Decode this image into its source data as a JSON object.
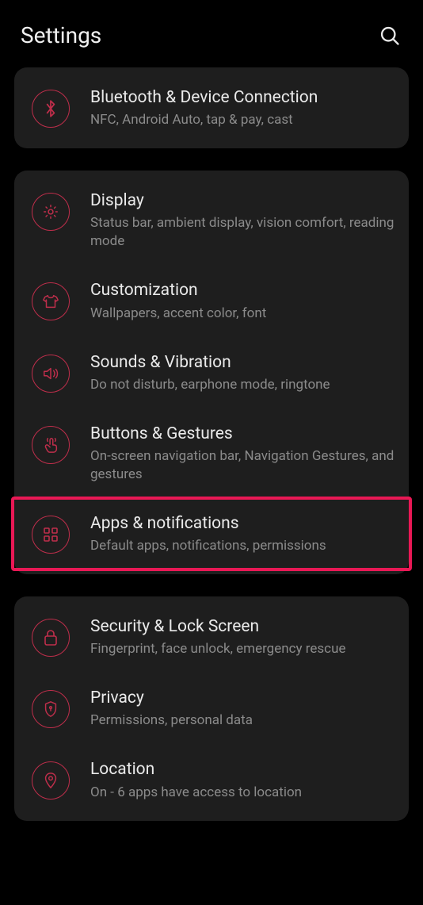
{
  "header": {
    "title": "Settings"
  },
  "groups": [
    {
      "items": [
        {
          "icon": "bluetooth",
          "title": "Bluetooth & Device Connection",
          "sub": "NFC, Android Auto, tap & pay, cast"
        }
      ]
    },
    {
      "items": [
        {
          "icon": "display",
          "title": "Display",
          "sub": "Status bar, ambient display, vision comfort, reading mode"
        },
        {
          "icon": "tshirt",
          "title": "Customization",
          "sub": "Wallpapers, accent color, font"
        },
        {
          "icon": "sound",
          "title": "Sounds & Vibration",
          "sub": "Do not disturb, earphone mode, ringtone"
        },
        {
          "icon": "gesture",
          "title": "Buttons & Gestures",
          "sub": "On-screen navigation bar, Navigation Gestures, and gestures"
        },
        {
          "icon": "apps",
          "title": "Apps & notifications",
          "sub": "Default apps, notifications, permissions",
          "highlight": true
        }
      ]
    },
    {
      "items": [
        {
          "icon": "lock",
          "title": "Security & Lock Screen",
          "sub": "Fingerprint, face unlock, emergency rescue"
        },
        {
          "icon": "shield",
          "title": "Privacy",
          "sub": "Permissions, personal data"
        },
        {
          "icon": "location",
          "title": "Location",
          "sub": "On - 6 apps have access to location"
        }
      ]
    }
  ],
  "colors": {
    "accent": "#bf2e4b",
    "highlight": "#e91855"
  }
}
